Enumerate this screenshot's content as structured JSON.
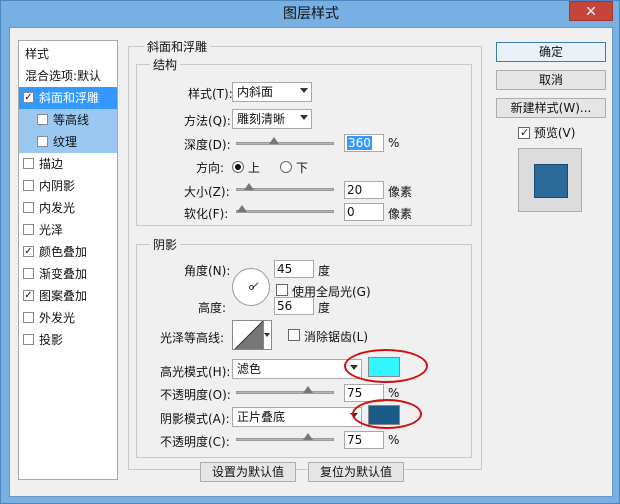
{
  "window": {
    "title": "图层样式",
    "close": "✕"
  },
  "sidebar": {
    "items": [
      {
        "label": "样式",
        "checkbox": false,
        "checked": false
      },
      {
        "label": "混合选项:默认",
        "checkbox": false,
        "checked": false
      },
      {
        "label": "斜面和浮雕",
        "checkbox": true,
        "checked": true,
        "state": "selected"
      },
      {
        "label": "等高线",
        "checkbox": true,
        "checked": false,
        "state": "sub"
      },
      {
        "label": "纹理",
        "checkbox": true,
        "checked": false,
        "state": "sub"
      },
      {
        "label": "描边",
        "checkbox": true,
        "checked": false
      },
      {
        "label": "内阴影",
        "checkbox": true,
        "checked": false
      },
      {
        "label": "内发光",
        "checkbox": true,
        "checked": false
      },
      {
        "label": "光泽",
        "checkbox": true,
        "checked": false
      },
      {
        "label": "颜色叠加",
        "checkbox": true,
        "checked": true
      },
      {
        "label": "渐变叠加",
        "checkbox": true,
        "checked": false
      },
      {
        "label": "图案叠加",
        "checkbox": true,
        "checked": true
      },
      {
        "label": "外发光",
        "checkbox": true,
        "checked": false
      },
      {
        "label": "投影",
        "checkbox": true,
        "checked": false
      }
    ]
  },
  "buttons": {
    "ok": "确定",
    "cancel": "取消",
    "new_style": "新建样式(W)...",
    "preview": "预览(V)",
    "preview_checked": true,
    "make_default": "设置为默认值",
    "reset_default": "复位为默认值"
  },
  "bevel": {
    "group_title": "斜面和浮雕",
    "structure_title": "结构",
    "style_label": "样式(T):",
    "style_value": "内斜面",
    "technique_label": "方法(Q):",
    "technique_value": "雕刻清晰",
    "depth_label": "深度(D):",
    "depth_value": "360",
    "depth_unit": "%",
    "direction_label": "方向:",
    "direction_up": "上",
    "direction_down": "下",
    "direction_selected": "上",
    "size_label": "大小(Z):",
    "size_value": "20",
    "size_unit": "像素",
    "soften_label": "软化(F):",
    "soften_value": "0",
    "soften_unit": "像素"
  },
  "shading": {
    "title": "阴影",
    "angle_label": "角度(N):",
    "angle_value": "45",
    "angle_unit": "度",
    "global_light_label": "使用全局光(G)",
    "global_light_checked": false,
    "altitude_label": "高度:",
    "altitude_value": "56",
    "altitude_unit": "度",
    "gloss_contour_label": "光泽等高线:",
    "antialiased_label": "消除锯齿(L)",
    "antialiased_checked": false,
    "highlight_mode_label": "高光模式(H):",
    "highlight_mode_value": "滤色",
    "highlight_color": "#33f5ff",
    "highlight_opacity_label": "不透明度(O):",
    "highlight_opacity_value": "75",
    "shadow_mode_label": "阴影模式(A):",
    "shadow_mode_value": "正片叠底",
    "shadow_color": "#1a5a86",
    "shadow_opacity_label": "不透明度(C):",
    "shadow_opacity_value": "75",
    "percent_unit": "%"
  },
  "sliders": {
    "depth_level": 0.36,
    "size_level": 0.08,
    "soften_level": 0.0,
    "highlight_opacity_level": 0.75,
    "shadow_opacity_level": 0.75
  },
  "annotation_color": "#d01010"
}
